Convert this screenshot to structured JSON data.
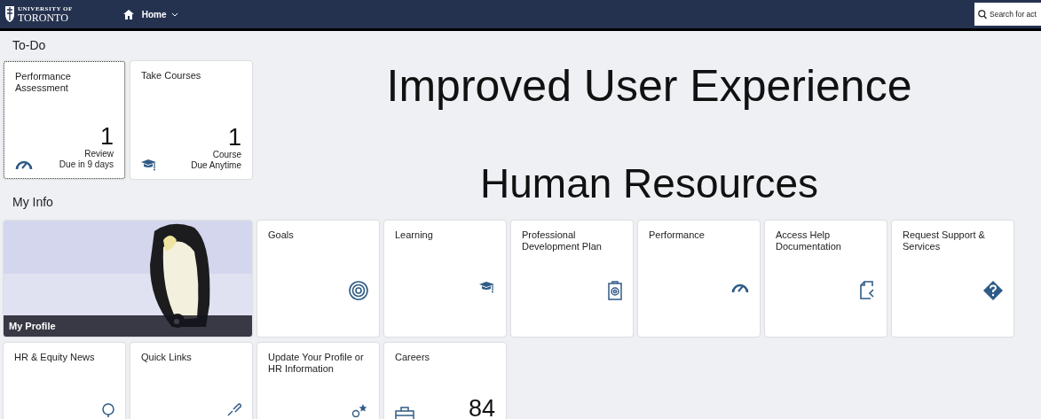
{
  "header": {
    "logo_small": "UNIVERSITY OF",
    "logo_large": "TORONTO",
    "nav_title": "Home",
    "search": {
      "placeholder": "Search for act"
    }
  },
  "todo": {
    "title": "To-Do",
    "tiles": [
      {
        "title": "Performance Assessment",
        "number": "1",
        "footer": [
          "Review",
          "Due in 9 days"
        ],
        "focused": true
      },
      {
        "title": "Take Courses",
        "number": "1",
        "footer": [
          "Course",
          "Due Anytime"
        ],
        "focused": false
      }
    ]
  },
  "overlay_text": [
    "Improved User Experience",
    "Human Resources"
  ],
  "my_info": {
    "title": "My Info",
    "tiles": [
      {
        "kind": "picture",
        "title": "My Profile"
      },
      {
        "kind": "launch",
        "title": "Goals"
      },
      {
        "kind": "launch",
        "title": "Learning"
      },
      {
        "kind": "launch",
        "title": "Professional Development Plan"
      },
      {
        "kind": "launch",
        "title": "Performance"
      },
      {
        "kind": "launch",
        "title": "Access Help Documentation"
      },
      {
        "kind": "launch",
        "title": "Request Support & Services"
      },
      {
        "kind": "launch",
        "title": "HR & Equity News"
      },
      {
        "kind": "launch",
        "title": "Quick Links"
      },
      {
        "kind": "launch",
        "title": "Update Your Profile or HR Information"
      },
      {
        "kind": "numeric",
        "title": "Careers",
        "number": "84"
      }
    ]
  }
}
